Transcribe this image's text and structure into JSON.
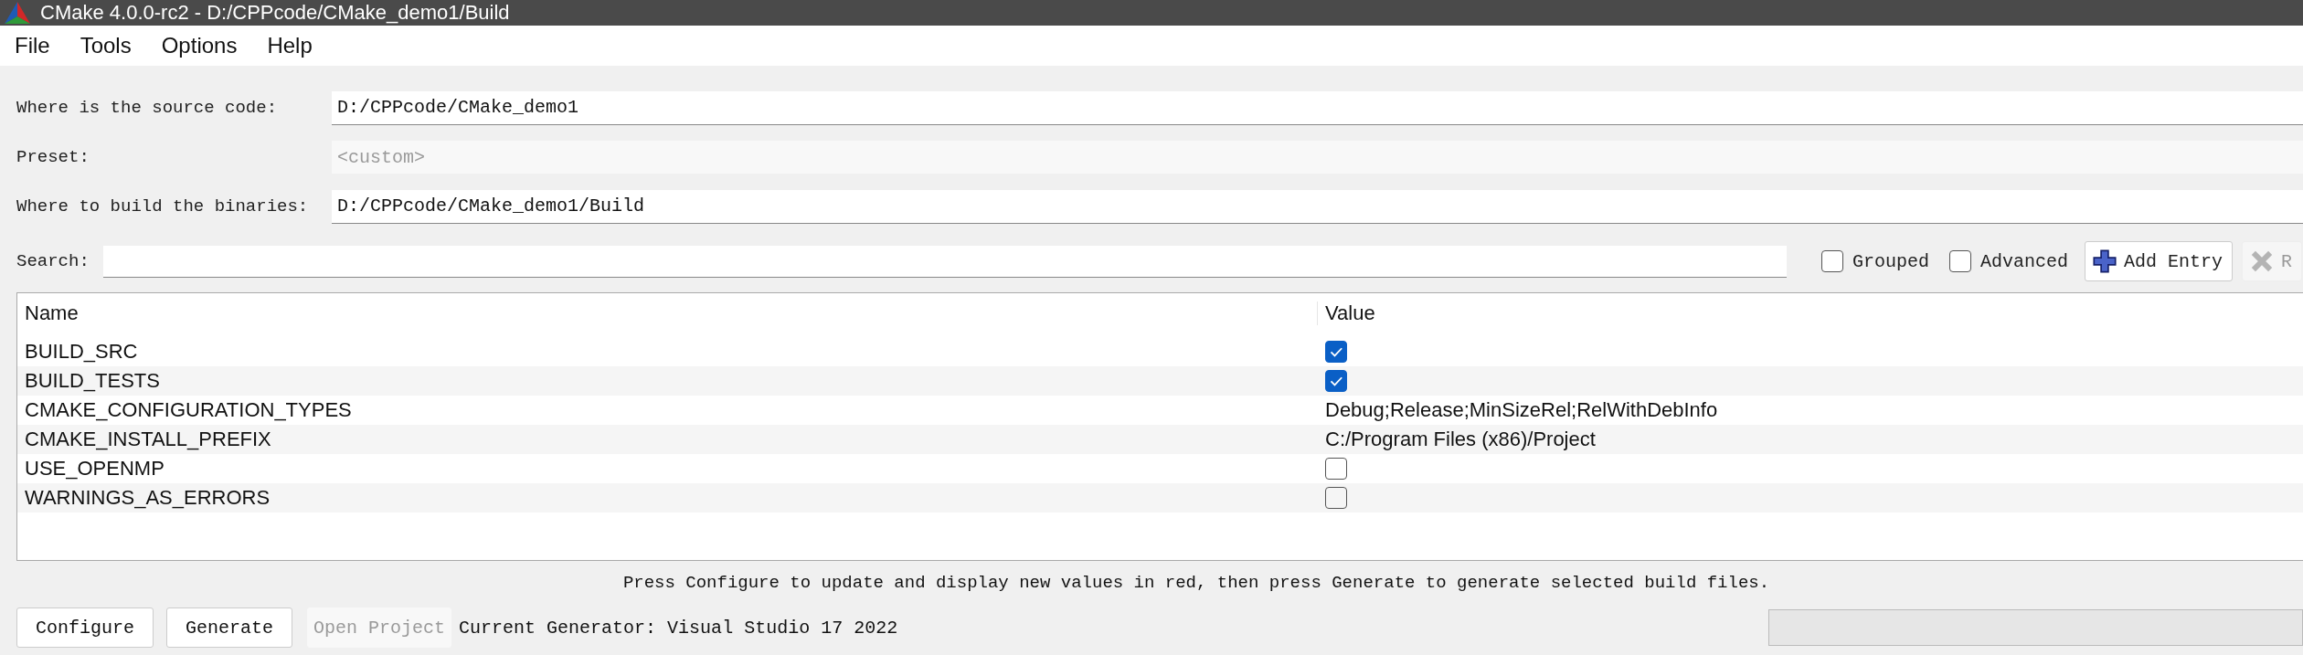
{
  "window": {
    "title": "CMake 4.0.0-rc2 - D:/CPPcode/CMake_demo1/Build"
  },
  "menu": [
    {
      "label": "File"
    },
    {
      "label": "Tools"
    },
    {
      "label": "Options"
    },
    {
      "label": "Help"
    }
  ],
  "paths": [
    {
      "label": "Where is the source code:",
      "value": "D:/CPPcode/CMake_demo1",
      "disabled": false
    },
    {
      "label": "Preset:",
      "placeholder": "<custom>",
      "disabled": true
    },
    {
      "label": "Where to build the binaries:",
      "value": "D:/CPPcode/CMake_demo1/Build",
      "disabled": false
    }
  ],
  "search": {
    "label": "Search:"
  },
  "options": [
    {
      "label": "Grouped",
      "checked": false
    },
    {
      "label": "Advanced",
      "checked": false
    }
  ],
  "entry_buttons": [
    {
      "label": "Add Entry",
      "kind": "add",
      "disabled": false
    },
    {
      "label": "R",
      "kind": "remove",
      "disabled": true
    }
  ],
  "table": {
    "columns": [
      "Name",
      "Value"
    ],
    "rows": [
      {
        "name": "BUILD_SRC",
        "kind": "bool",
        "checked": true
      },
      {
        "name": "BUILD_TESTS",
        "kind": "bool",
        "checked": true
      },
      {
        "name": "CMAKE_CONFIGURATION_TYPES",
        "kind": "text",
        "value": "Debug;Release;MinSizeRel;RelWithDebInfo"
      },
      {
        "name": "CMAKE_INSTALL_PREFIX",
        "kind": "text",
        "value": "C:/Program Files (x86)/Project"
      },
      {
        "name": "USE_OPENMP",
        "kind": "bool",
        "checked": false
      },
      {
        "name": "WARNINGS_AS_ERRORS",
        "kind": "bool",
        "checked": false
      }
    ]
  },
  "status_message": "Press Configure to update and display new values in red, then press Generate to generate selected build files.",
  "buttons": [
    {
      "label": "Configure",
      "disabled": false
    },
    {
      "label": "Generate",
      "disabled": false
    },
    {
      "label": "Open Project",
      "disabled": true
    }
  ],
  "generator": "Current Generator: Visual Studio 17 2022",
  "progress": {
    "level": 0
  }
}
